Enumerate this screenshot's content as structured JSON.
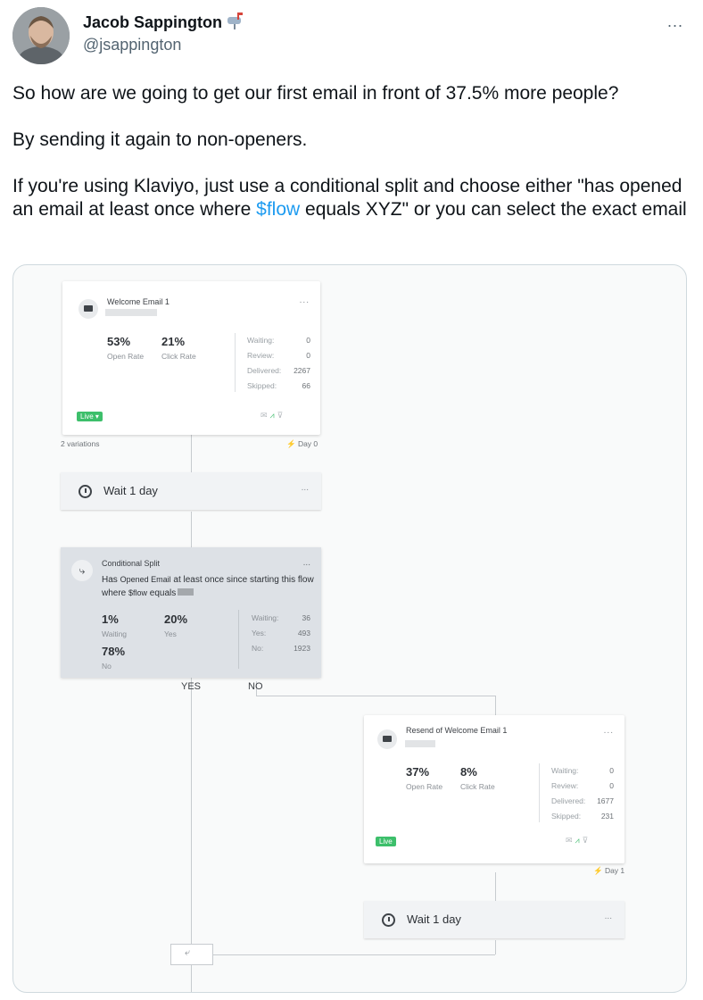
{
  "author": {
    "name": "Jacob Sappington",
    "handle": "@jsappington",
    "badge_icon": "mailbox-icon"
  },
  "more_label": "...",
  "tweet": {
    "line1": "So how are we going to get our first email in front of 37.5% more people?",
    "line2": "By sending it again to non-openers.",
    "line3_pre": "If you're using Klaviyo, just use a conditional split and choose either \"has opened an email at least once where ",
    "line3_link": "$flow",
    "line3_post": " equals XYZ\" or you can select the exact email"
  },
  "flow": {
    "card1": {
      "title": "Welcome Email 1",
      "dots": "...",
      "open_rate": "53%",
      "open_rate_label": "Open Rate",
      "click_rate": "21%",
      "click_rate_label": "Click Rate",
      "stats": [
        {
          "label": "Waiting:",
          "value": "0"
        },
        {
          "label": "Review:",
          "value": "0"
        },
        {
          "label": "Delivered:",
          "value": "2267"
        },
        {
          "label": "Skipped:",
          "value": "66"
        }
      ],
      "status": "Live ▾",
      "variations": "2 variations",
      "day": "⚡ Day 0"
    },
    "wait1": {
      "text": "Wait 1 day",
      "dots": "..."
    },
    "split": {
      "title": "Conditional Split",
      "dots": "...",
      "desc_pre": "Has ",
      "desc_em": "Opened Email",
      "desc_mid": " at least once since starting this flow where ",
      "desc_flow": "$flow",
      "desc_post": " equals",
      "waiting_pct": "1%",
      "waiting_label": "Waiting",
      "yes_pct": "20%",
      "yes_label": "Yes",
      "no_pct": "78%",
      "no_label": "No",
      "stats": [
        {
          "label": "Waiting:",
          "value": "36"
        },
        {
          "label": "Yes:",
          "value": "493"
        },
        {
          "label": "No:",
          "value": "1923"
        }
      ]
    },
    "branch_yes": "YES",
    "branch_no": "NO",
    "card2": {
      "title": "Resend of Welcome Email 1",
      "dots": "...",
      "open_rate": "37%",
      "open_rate_label": "Open Rate",
      "click_rate": "8%",
      "click_rate_label": "Click Rate",
      "stats": [
        {
          "label": "Waiting:",
          "value": "0"
        },
        {
          "label": "Review:",
          "value": "0"
        },
        {
          "label": "Delivered:",
          "value": "1677"
        },
        {
          "label": "Skipped:",
          "value": "231"
        }
      ],
      "status": "Live",
      "day": "⚡ Day 1"
    },
    "wait2": {
      "text": "Wait 1 day",
      "dots": "..."
    },
    "merge_icon": "merge-icon",
    "colors": {
      "live_green": "#3dbf6b",
      "split_bg": "#dde1e6",
      "link_blue": "#1d9bf0"
    }
  }
}
